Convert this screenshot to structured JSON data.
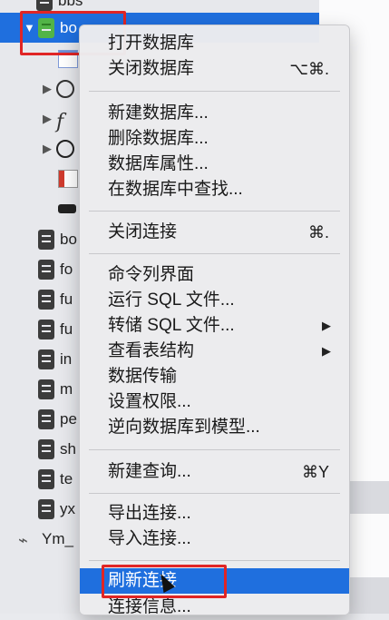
{
  "tree": {
    "top_item": "bbs",
    "selected_item": "bo",
    "items": [
      "bo",
      "fo",
      "fu",
      "fu",
      "in",
      "m",
      "pe",
      "sh",
      "te",
      "yx"
    ],
    "connection": "Ym_"
  },
  "menu": {
    "items": [
      {
        "label": "打开数据库",
        "shortcut": ""
      },
      {
        "label": "关闭数据库",
        "shortcut": "⌥⌘."
      },
      {
        "label": "新建数据库...",
        "shortcut": ""
      },
      {
        "label": "删除数据库...",
        "shortcut": ""
      },
      {
        "label": "数据库属性...",
        "shortcut": ""
      },
      {
        "label": "在数据库中查找...",
        "shortcut": ""
      },
      {
        "label": "关闭连接",
        "shortcut": "⌘."
      },
      {
        "label": "命令列界面",
        "shortcut": ""
      },
      {
        "label": "运行 SQL 文件...",
        "shortcut": ""
      },
      {
        "label": "转储 SQL 文件...",
        "shortcut": "▶"
      },
      {
        "label": "查看表结构",
        "shortcut": "▶"
      },
      {
        "label": "数据传输",
        "shortcut": ""
      },
      {
        "label": "设置权限...",
        "shortcut": ""
      },
      {
        "label": "逆向数据库到模型...",
        "shortcut": ""
      },
      {
        "label": "新建查询...",
        "shortcut": "⌘Y"
      },
      {
        "label": "导出连接...",
        "shortcut": ""
      },
      {
        "label": "导入连接...",
        "shortcut": ""
      },
      {
        "label": "刷新连接",
        "shortcut": ""
      },
      {
        "label": "连接信息...",
        "shortcut": ""
      }
    ]
  },
  "colors": {
    "selection": "#1f6fde",
    "highlight_box": "#e02525",
    "db_selected": "#52b447"
  }
}
